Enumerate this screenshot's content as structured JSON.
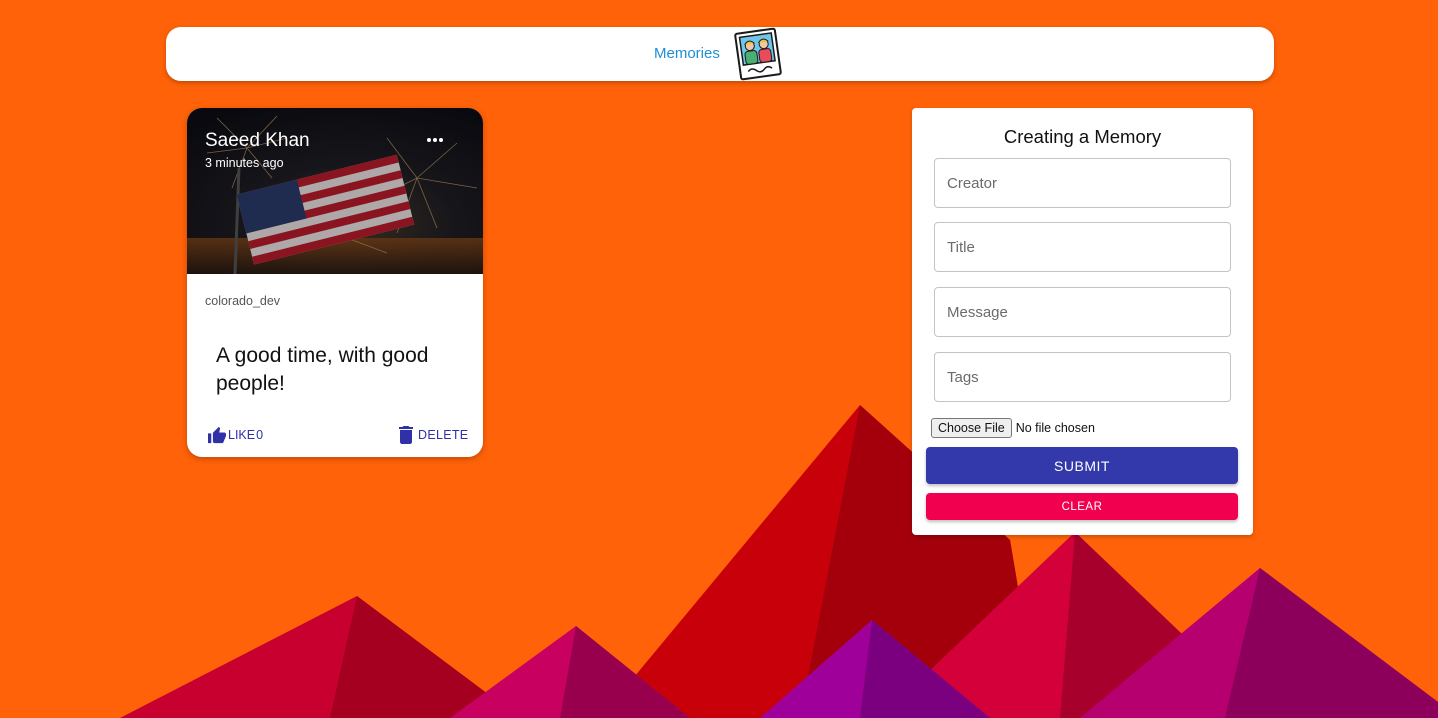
{
  "theme": {
    "background": "#ff6208",
    "primary": "#3339aa",
    "secondary": "#f0004f",
    "brand_text": "#1e8fd6"
  },
  "appbar": {
    "title": "Memories",
    "logo_icon": "memories-photo-icon"
  },
  "posts": [
    {
      "creator": "Saeed Khan",
      "time_ago": "3 minutes ago",
      "tags": "colorado_dev",
      "message": "A good time, with good people!",
      "like_label": "LIKE",
      "like_count": "0",
      "delete_label": "DELETE",
      "like_icon": "thumb-up-icon",
      "delete_icon": "trash-icon",
      "more_icon": "more-horizontal-icon"
    }
  ],
  "form": {
    "title": "Creating a Memory",
    "creator_placeholder": "Creator",
    "title_placeholder": "Title",
    "message_placeholder": "Message",
    "tags_placeholder": "Tags",
    "file_button_label": "Choose File",
    "file_status": "No file chosen",
    "submit_label": "SUBMIT",
    "clear_label": "CLEAR"
  }
}
